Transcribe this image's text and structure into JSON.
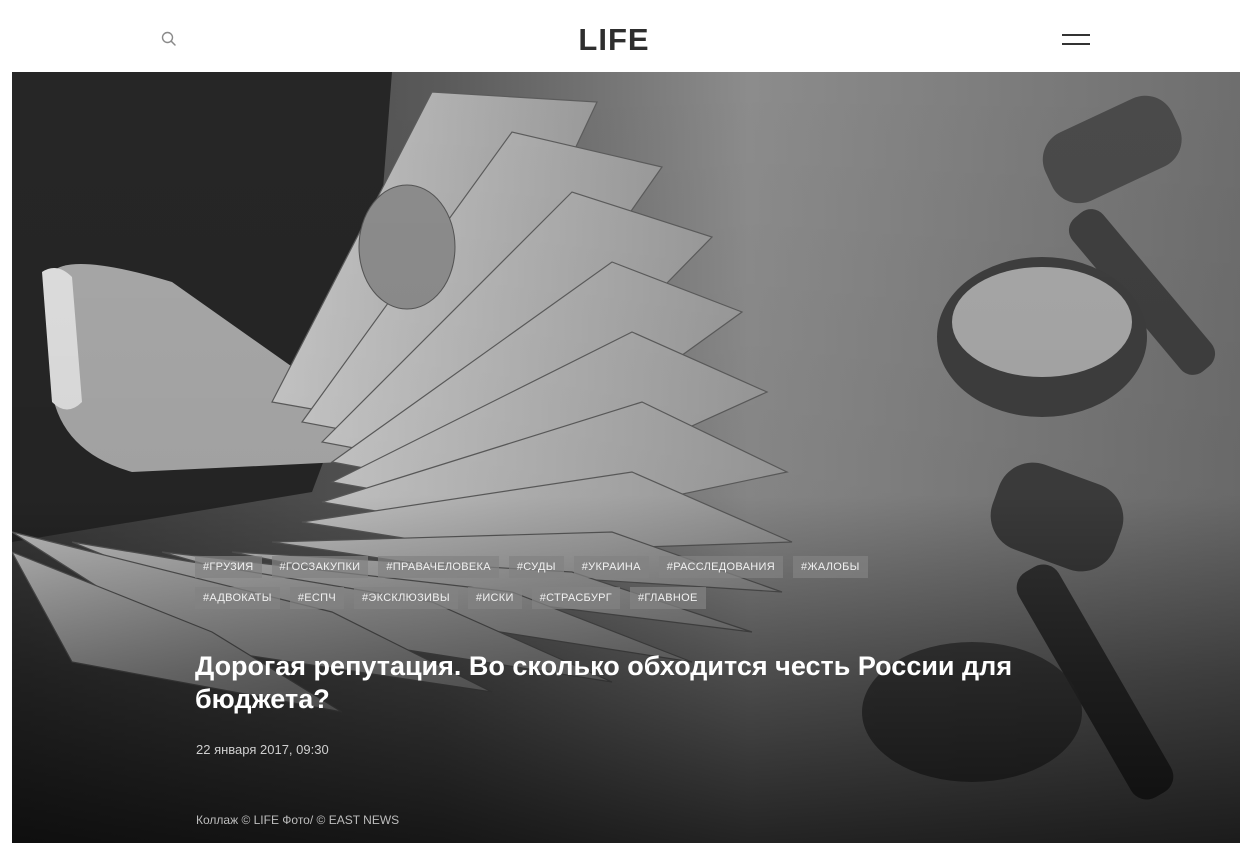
{
  "header": {
    "logo": "LIFE",
    "search_icon": "search-icon",
    "menu_icon": "hamburger-menu-icon"
  },
  "article": {
    "tags_row1": [
      "#ГРУЗИЯ",
      "#ГОСЗАКУПКИ",
      "#ПРАВАЧЕЛОВЕКА",
      "#СУДЫ",
      "#УКРАИНА",
      "#РАССЛЕДОВАНИЯ",
      "#ЖАЛОБЫ"
    ],
    "tags_row2": [
      "#АДВОКАТЫ",
      "#ЕСПЧ",
      "#ЭКСКЛЮЗИВЫ",
      "#ИСКИ",
      "#СТРАСБУРГ",
      "#ГЛАВНОЕ"
    ],
    "title": "Дорогая репутация. Во сколько обходится честь России для бюджета?",
    "date": "22 января 2017, 09:30",
    "photo_credit": "Коллаж © LIFE Фото/ © EAST NEWS"
  },
  "colors": {
    "header_bg": "#ffffff",
    "logo": "#2e2e2e",
    "tag_bg": "#828282",
    "title": "#ffffff"
  }
}
